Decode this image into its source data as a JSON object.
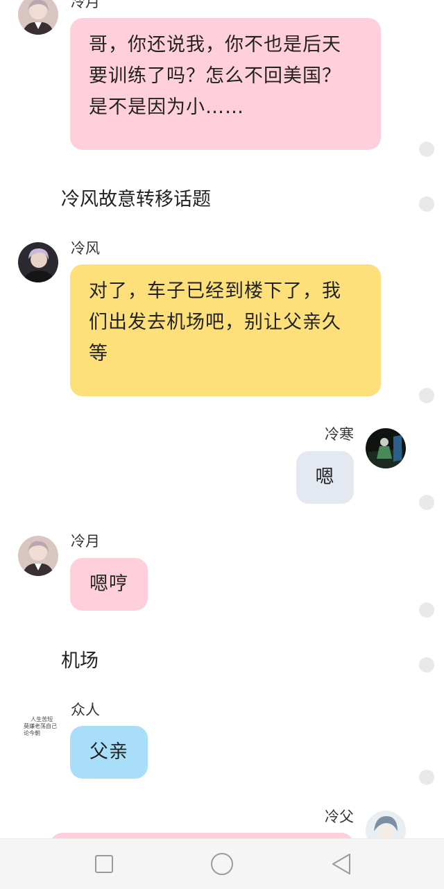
{
  "colors": {
    "pink_bubble": "#ffd0dc",
    "yellow_bubble": "#fde07a",
    "grey_bubble": "#e3e8f1",
    "blue_bubble": "#a9def9",
    "dot": "#e9e9e9",
    "navbar": "#f5f5f5"
  },
  "messages": {
    "m1": {
      "sender": "冷月",
      "text": "哥，你还说我，你不也是后天\n要训练了吗？怎么不回美国？\n是不是因为小……"
    },
    "n1": {
      "text": "冷风故意转移话题"
    },
    "m2": {
      "sender": "冷风",
      "text": "对了，车子已经到楼下了，我\n们出发去机场吧，别让父亲久\n等"
    },
    "m3": {
      "sender": "冷寒",
      "text": "嗯"
    },
    "m4": {
      "sender": "冷月",
      "text": "嗯哼"
    },
    "n2": {
      "text": "机场"
    },
    "m5": {
      "sender": "众人",
      "avatar_text": "人生苦短\n莫嫌老荡自己\n论今朝",
      "text": "父亲"
    },
    "m6": {
      "sender": "冷父"
    }
  },
  "navbar": {
    "recent_icon": "square-icon",
    "home_icon": "circle-icon",
    "back_icon": "triangle-back-icon"
  }
}
